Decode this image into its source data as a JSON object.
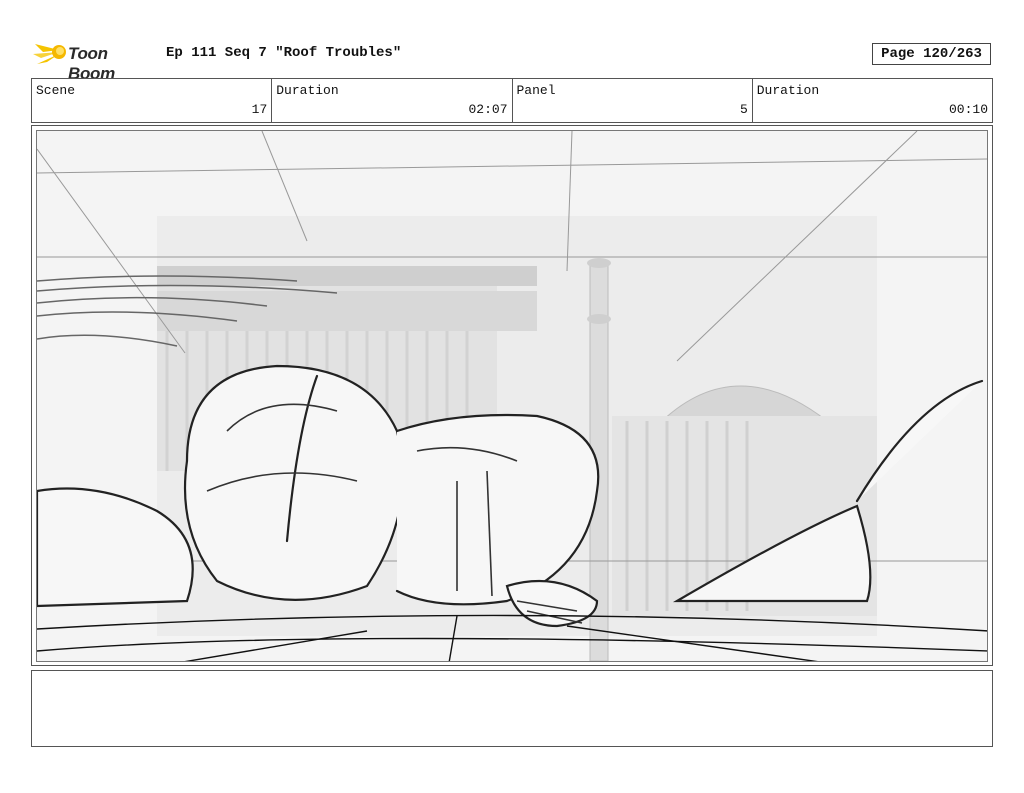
{
  "header": {
    "logo_text": "Toon Boom",
    "title": "Ep 111 Seq 7 \"Roof Troubles\"",
    "page": "Page 120/263"
  },
  "info": {
    "scene_label": "Scene",
    "scene_value": "17",
    "scene_duration_label": "Duration",
    "scene_duration_value": "02:07",
    "panel_label": "Panel",
    "panel_value": "5",
    "panel_duration_label": "Duration",
    "panel_duration_value": "00:10"
  },
  "panel": {
    "image_icon": "storyboard-sketch-icon"
  },
  "notes": {
    "text": ""
  },
  "colors": {
    "logo_yellow": "#f5c400",
    "border": "#555555"
  }
}
